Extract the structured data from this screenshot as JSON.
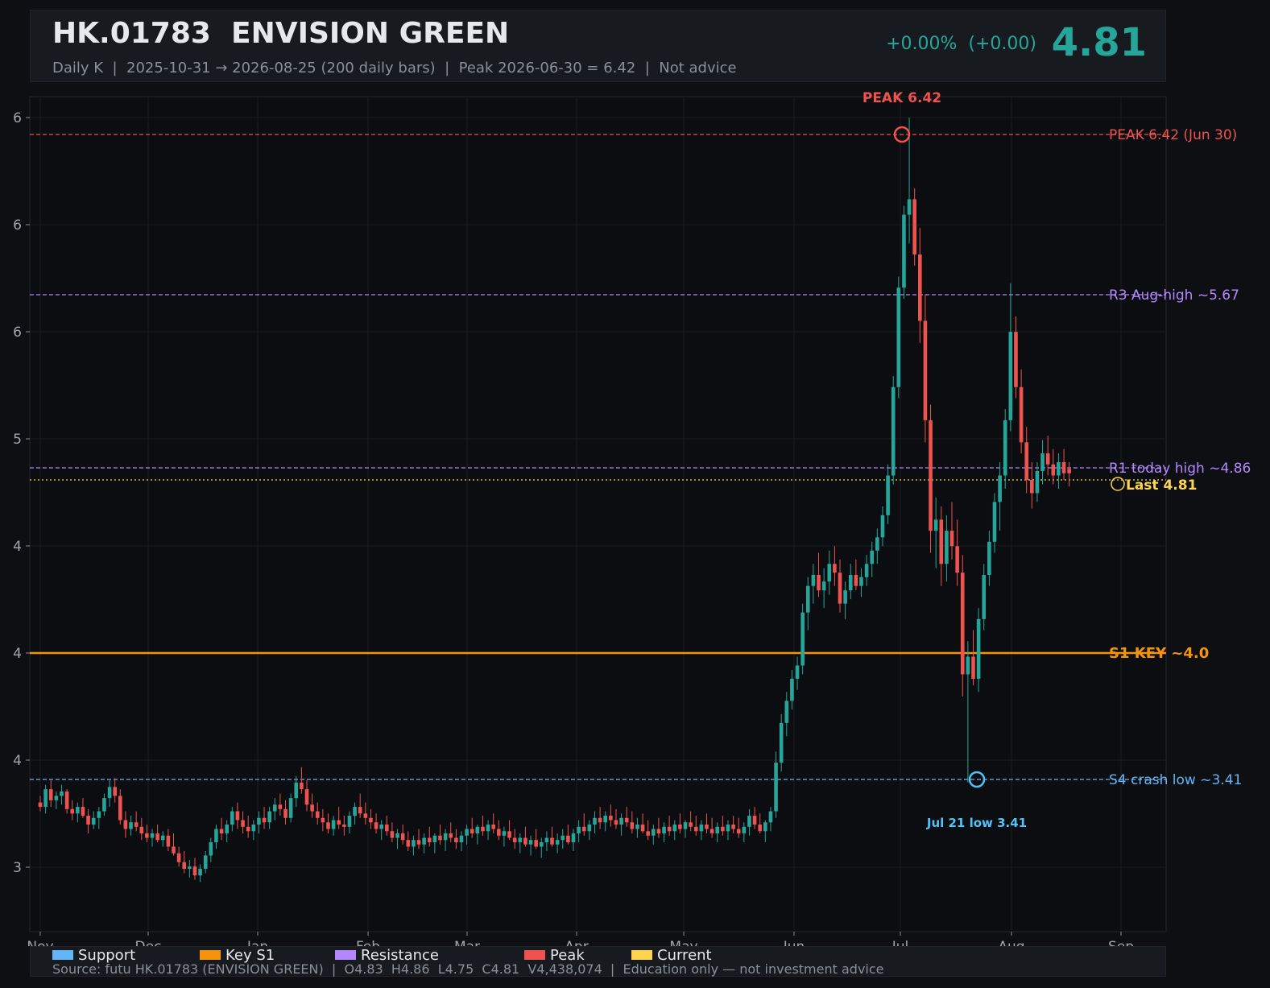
{
  "header": {
    "title": "HK.01783  ENVISION GREEN",
    "subtitle": "Daily K  |  2025-10-31 → 2026-08-25 (200 daily bars)  |  Peak 2026-06-30 = 6.42  |  Not advice",
    "change": "+0.00%  (+0.00)",
    "price": "4.81"
  },
  "colors": {
    "up": "#26a69a",
    "down": "#ef5350",
    "support": "#64b5f6",
    "key_s1": "#f5940c",
    "resistance": "#b388ff",
    "peak": "#ef5350",
    "current": "#ffd54f"
  },
  "chart_data": {
    "type": "candlestick",
    "x_start": "2025-10-31",
    "x_end": "2026-08-25",
    "bars": 200,
    "x_ticks": [
      "Nov",
      "Dec",
      "Jan",
      "Feb",
      "Mar",
      "Apr",
      "May",
      "Jun",
      "Jul",
      "Aug",
      "Sep"
    ],
    "y_ticks": [
      "3",
      "4",
      "4",
      "4",
      "5",
      "6",
      "6",
      "6"
    ],
    "ylim": [
      2.9,
      6.6
    ],
    "grid": true,
    "levels": [
      {
        "label": "PEAK 6.42 (Jun 30)",
        "value": 6.42,
        "kind": "peak",
        "style": "dashed"
      },
      {
        "label": "R3 Aug-high ~5.67",
        "value": 5.67,
        "kind": "resistance",
        "style": "dashed"
      },
      {
        "label": "R1 today high ~4.86",
        "value": 4.86,
        "kind": "resistance",
        "style": "dashed"
      },
      {
        "label": "Last 4.81",
        "value": 4.81,
        "kind": "current",
        "style": "dotted"
      },
      {
        "label": "S1 KEY ~4.0",
        "value": 4.0,
        "kind": "key_s1",
        "style": "solid"
      },
      {
        "label": "S4 crash low ~3.41",
        "value": 3.41,
        "kind": "support",
        "style": "dashed"
      }
    ],
    "annotations": [
      {
        "text": "PEAK 6.42",
        "date": "2026-06-30",
        "value": 6.42,
        "kind": "peak"
      },
      {
        "text": "Jul 21 low 3.41",
        "date": "2026-07-21",
        "value": 3.41,
        "kind": "support"
      }
    ],
    "ohlc": [
      [
        3.32,
        3.35,
        3.28,
        3.3
      ],
      [
        3.3,
        3.4,
        3.27,
        3.38
      ],
      [
        3.38,
        3.42,
        3.3,
        3.33
      ],
      [
        3.33,
        3.37,
        3.29,
        3.35
      ],
      [
        3.35,
        3.4,
        3.31,
        3.37
      ],
      [
        3.37,
        3.38,
        3.27,
        3.29
      ],
      [
        3.29,
        3.33,
        3.24,
        3.27
      ],
      [
        3.27,
        3.32,
        3.23,
        3.3
      ],
      [
        3.3,
        3.34,
        3.25,
        3.26
      ],
      [
        3.26,
        3.29,
        3.18,
        3.22
      ],
      [
        3.22,
        3.28,
        3.2,
        3.25
      ],
      [
        3.25,
        3.3,
        3.2,
        3.28
      ],
      [
        3.28,
        3.36,
        3.26,
        3.34
      ],
      [
        3.34,
        3.42,
        3.3,
        3.39
      ],
      [
        3.39,
        3.43,
        3.32,
        3.35
      ],
      [
        3.35,
        3.38,
        3.22,
        3.24
      ],
      [
        3.24,
        3.28,
        3.16,
        3.2
      ],
      [
        3.2,
        3.26,
        3.17,
        3.23
      ],
      [
        3.23,
        3.28,
        3.19,
        3.21
      ],
      [
        3.21,
        3.25,
        3.15,
        3.18
      ],
      [
        3.18,
        3.22,
        3.14,
        3.16
      ],
      [
        3.16,
        3.2,
        3.12,
        3.18
      ],
      [
        3.18,
        3.22,
        3.14,
        3.15
      ],
      [
        3.15,
        3.19,
        3.12,
        3.17
      ],
      [
        3.17,
        3.2,
        3.1,
        3.12
      ],
      [
        3.12,
        3.18,
        3.08,
        3.09
      ],
      [
        3.09,
        3.12,
        3.03,
        3.05
      ],
      [
        3.05,
        3.1,
        3.0,
        3.02
      ],
      [
        3.02,
        3.06,
        2.98,
        3.03
      ],
      [
        3.03,
        3.07,
        2.97,
        2.99
      ],
      [
        2.99,
        3.04,
        2.96,
        3.02
      ],
      [
        3.02,
        3.1,
        3.0,
        3.08
      ],
      [
        3.08,
        3.16,
        3.05,
        3.14
      ],
      [
        3.14,
        3.22,
        3.11,
        3.2
      ],
      [
        3.2,
        3.25,
        3.15,
        3.18
      ],
      [
        3.18,
        3.24,
        3.14,
        3.22
      ],
      [
        3.22,
        3.3,
        3.19,
        3.28
      ],
      [
        3.28,
        3.32,
        3.2,
        3.24
      ],
      [
        3.24,
        3.28,
        3.18,
        3.21
      ],
      [
        3.21,
        3.26,
        3.16,
        3.19
      ],
      [
        3.19,
        3.24,
        3.15,
        3.22
      ],
      [
        3.22,
        3.28,
        3.18,
        3.25
      ],
      [
        3.25,
        3.3,
        3.2,
        3.23
      ],
      [
        3.23,
        3.3,
        3.2,
        3.28
      ],
      [
        3.28,
        3.34,
        3.24,
        3.31
      ],
      [
        3.31,
        3.36,
        3.26,
        3.29
      ],
      [
        3.29,
        3.33,
        3.22,
        3.25
      ],
      [
        3.25,
        3.36,
        3.23,
        3.34
      ],
      [
        3.34,
        3.44,
        3.3,
        3.41
      ],
      [
        3.41,
        3.48,
        3.36,
        3.38
      ],
      [
        3.38,
        3.42,
        3.28,
        3.31
      ],
      [
        3.31,
        3.36,
        3.25,
        3.28
      ],
      [
        3.28,
        3.32,
        3.22,
        3.25
      ],
      [
        3.25,
        3.29,
        3.19,
        3.23
      ],
      [
        3.23,
        3.27,
        3.18,
        3.2
      ],
      [
        3.2,
        3.26,
        3.17,
        3.24
      ],
      [
        3.24,
        3.3,
        3.2,
        3.22
      ],
      [
        3.22,
        3.26,
        3.17,
        3.21
      ],
      [
        3.21,
        3.28,
        3.18,
        3.26
      ],
      [
        3.26,
        3.32,
        3.22,
        3.3
      ],
      [
        3.3,
        3.36,
        3.25,
        3.27
      ],
      [
        3.27,
        3.32,
        3.22,
        3.25
      ],
      [
        3.25,
        3.29,
        3.2,
        3.23
      ],
      [
        3.23,
        3.27,
        3.18,
        3.2
      ],
      [
        3.2,
        3.24,
        3.15,
        3.22
      ],
      [
        3.22,
        3.26,
        3.17,
        3.19
      ],
      [
        3.19,
        3.23,
        3.14,
        3.16
      ],
      [
        3.16,
        3.2,
        3.11,
        3.18
      ],
      [
        3.18,
        3.22,
        3.13,
        3.15
      ],
      [
        3.15,
        3.19,
        3.1,
        3.12
      ],
      [
        3.12,
        3.17,
        3.08,
        3.15
      ],
      [
        3.15,
        3.2,
        3.11,
        3.13
      ],
      [
        3.13,
        3.18,
        3.09,
        3.16
      ],
      [
        3.16,
        3.21,
        3.12,
        3.14
      ],
      [
        3.14,
        3.18,
        3.09,
        3.17
      ],
      [
        3.17,
        3.22,
        3.13,
        3.15
      ],
      [
        3.15,
        3.2,
        3.1,
        3.18
      ],
      [
        3.18,
        3.23,
        3.14,
        3.16
      ],
      [
        3.16,
        3.2,
        3.11,
        3.14
      ],
      [
        3.14,
        3.19,
        3.1,
        3.17
      ],
      [
        3.17,
        3.22,
        3.13,
        3.2
      ],
      [
        3.2,
        3.25,
        3.16,
        3.18
      ],
      [
        3.18,
        3.22,
        3.13,
        3.21
      ],
      [
        3.21,
        3.26,
        3.17,
        3.19
      ],
      [
        3.19,
        3.24,
        3.15,
        3.22
      ],
      [
        3.22,
        3.27,
        3.18,
        3.2
      ],
      [
        3.2,
        3.24,
        3.15,
        3.17
      ],
      [
        3.17,
        3.21,
        3.12,
        3.19
      ],
      [
        3.19,
        3.24,
        3.15,
        3.16
      ],
      [
        3.16,
        3.2,
        3.11,
        3.14
      ],
      [
        3.14,
        3.18,
        3.09,
        3.16
      ],
      [
        3.16,
        3.21,
        3.12,
        3.13
      ],
      [
        3.13,
        3.17,
        3.08,
        3.15
      ],
      [
        3.15,
        3.2,
        3.11,
        3.12
      ],
      [
        3.12,
        3.16,
        3.07,
        3.14
      ],
      [
        3.14,
        3.19,
        3.1,
        3.16
      ],
      [
        3.16,
        3.21,
        3.12,
        3.13
      ],
      [
        3.13,
        3.18,
        3.09,
        3.15
      ],
      [
        3.15,
        3.2,
        3.11,
        3.17
      ],
      [
        3.17,
        3.22,
        3.13,
        3.14
      ],
      [
        3.14,
        3.2,
        3.1,
        3.18
      ],
      [
        3.18,
        3.24,
        3.14,
        3.21
      ],
      [
        3.21,
        3.27,
        3.17,
        3.19
      ],
      [
        3.19,
        3.24,
        3.15,
        3.22
      ],
      [
        3.22,
        3.28,
        3.18,
        3.25
      ],
      [
        3.25,
        3.3,
        3.2,
        3.23
      ],
      [
        3.23,
        3.28,
        3.19,
        3.26
      ],
      [
        3.26,
        3.31,
        3.21,
        3.24
      ],
      [
        3.24,
        3.29,
        3.2,
        3.22
      ],
      [
        3.22,
        3.27,
        3.17,
        3.25
      ],
      [
        3.25,
        3.3,
        3.21,
        3.23
      ],
      [
        3.23,
        3.28,
        3.18,
        3.2
      ],
      [
        3.2,
        3.25,
        3.16,
        3.22
      ],
      [
        3.22,
        3.27,
        3.18,
        3.19
      ],
      [
        3.19,
        3.24,
        3.15,
        3.17
      ],
      [
        3.17,
        3.22,
        3.13,
        3.2
      ],
      [
        3.2,
        3.25,
        3.16,
        3.18
      ],
      [
        3.18,
        3.23,
        3.14,
        3.21
      ],
      [
        3.21,
        3.26,
        3.17,
        3.19
      ],
      [
        3.19,
        3.24,
        3.15,
        3.22
      ],
      [
        3.22,
        3.27,
        3.18,
        3.2
      ],
      [
        3.2,
        3.24,
        3.16,
        3.23
      ],
      [
        3.23,
        3.28,
        3.19,
        3.21
      ],
      [
        3.21,
        3.26,
        3.17,
        3.19
      ],
      [
        3.19,
        3.24,
        3.15,
        3.22
      ],
      [
        3.22,
        3.27,
        3.18,
        3.2
      ],
      [
        3.2,
        3.25,
        3.16,
        3.18
      ],
      [
        3.18,
        3.23,
        3.14,
        3.21
      ],
      [
        3.21,
        3.26,
        3.17,
        3.19
      ],
      [
        3.19,
        3.24,
        3.15,
        3.22
      ],
      [
        3.22,
        3.26,
        3.18,
        3.2
      ],
      [
        3.2,
        3.25,
        3.16,
        3.18
      ],
      [
        3.18,
        3.23,
        3.14,
        3.21
      ],
      [
        3.21,
        3.29,
        3.17,
        3.26
      ],
      [
        3.26,
        3.3,
        3.2,
        3.22
      ],
      [
        3.22,
        3.27,
        3.18,
        3.19
      ],
      [
        3.19,
        3.24,
        3.14,
        3.23
      ],
      [
        3.23,
        3.3,
        3.19,
        3.28
      ],
      [
        3.28,
        3.55,
        3.25,
        3.5
      ],
      [
        3.5,
        3.72,
        3.46,
        3.68
      ],
      [
        3.68,
        3.82,
        3.62,
        3.78
      ],
      [
        3.78,
        3.92,
        3.74,
        3.88
      ],
      [
        3.88,
        3.98,
        3.83,
        3.94
      ],
      [
        3.94,
        4.22,
        3.9,
        4.18
      ],
      [
        4.18,
        4.34,
        4.1,
        4.3
      ],
      [
        4.3,
        4.4,
        4.22,
        4.35
      ],
      [
        4.35,
        4.45,
        4.25,
        4.28
      ],
      [
        4.28,
        4.38,
        4.2,
        4.32
      ],
      [
        4.32,
        4.46,
        4.26,
        4.4
      ],
      [
        4.4,
        4.48,
        4.3,
        4.36
      ],
      [
        4.36,
        4.42,
        4.18,
        4.22
      ],
      [
        4.22,
        4.32,
        4.15,
        4.28
      ],
      [
        4.28,
        4.4,
        4.24,
        4.35
      ],
      [
        4.35,
        4.42,
        4.28,
        4.3
      ],
      [
        4.3,
        4.38,
        4.25,
        4.34
      ],
      [
        4.34,
        4.44,
        4.3,
        4.4
      ],
      [
        4.4,
        4.5,
        4.34,
        4.46
      ],
      [
        4.46,
        4.56,
        4.4,
        4.52
      ],
      [
        4.52,
        4.66,
        4.48,
        4.62
      ],
      [
        4.62,
        4.85,
        4.58,
        4.8
      ],
      [
        4.8,
        5.25,
        4.76,
        5.2
      ],
      [
        5.2,
        5.7,
        5.15,
        5.65
      ],
      [
        5.65,
        6.02,
        5.6,
        5.98
      ],
      [
        5.98,
        6.42,
        5.85,
        6.05
      ],
      [
        6.05,
        6.1,
        5.75,
        5.8
      ],
      [
        5.8,
        5.92,
        5.4,
        5.5
      ],
      [
        5.5,
        5.62,
        4.95,
        5.05
      ],
      [
        5.05,
        5.12,
        4.45,
        4.55
      ],
      [
        4.55,
        4.7,
        4.38,
        4.6
      ],
      [
        4.6,
        4.66,
        4.3,
        4.4
      ],
      [
        4.4,
        4.62,
        4.32,
        4.55
      ],
      [
        4.55,
        4.68,
        4.42,
        4.48
      ],
      [
        4.48,
        4.6,
        4.3,
        4.36
      ],
      [
        4.36,
        4.44,
        3.8,
        3.9
      ],
      [
        3.9,
        4.05,
        3.41,
        3.98
      ],
      [
        3.98,
        4.1,
        3.85,
        3.88
      ],
      [
        3.88,
        4.2,
        3.82,
        4.15
      ],
      [
        4.15,
        4.4,
        4.1,
        4.35
      ],
      [
        4.35,
        4.55,
        4.3,
        4.5
      ],
      [
        4.5,
        4.72,
        4.45,
        4.68
      ],
      [
        4.68,
        4.86,
        4.55,
        4.8
      ],
      [
        4.8,
        5.1,
        4.74,
        5.05
      ],
      [
        5.05,
        5.67,
        5.0,
        5.45
      ],
      [
        5.45,
        5.52,
        5.15,
        5.2
      ],
      [
        5.2,
        5.28,
        4.9,
        4.95
      ],
      [
        4.95,
        5.02,
        4.72,
        4.78
      ],
      [
        4.78,
        4.86,
        4.65,
        4.72
      ],
      [
        4.72,
        4.86,
        4.68,
        4.82
      ],
      [
        4.82,
        4.96,
        4.76,
        4.9
      ],
      [
        4.9,
        4.98,
        4.8,
        4.85
      ],
      [
        4.85,
        4.92,
        4.76,
        4.8
      ],
      [
        4.8,
        4.9,
        4.74,
        4.86
      ],
      [
        4.86,
        4.92,
        4.78,
        4.81
      ],
      [
        4.83,
        4.86,
        4.75,
        4.81
      ]
    ]
  },
  "legend": {
    "items": [
      {
        "label": "Support",
        "kind": "support"
      },
      {
        "label": "Key S1",
        "kind": "key_s1"
      },
      {
        "label": "Resistance",
        "kind": "resistance"
      },
      {
        "label": "Peak",
        "kind": "peak"
      },
      {
        "label": "Current",
        "kind": "current"
      }
    ],
    "source": "Source: futu HK.01783 (ENVISION GREEN)  |  O4.83  H4.86  L4.75  C4.81  V4,438,074  |  Education only — not investment advice"
  }
}
